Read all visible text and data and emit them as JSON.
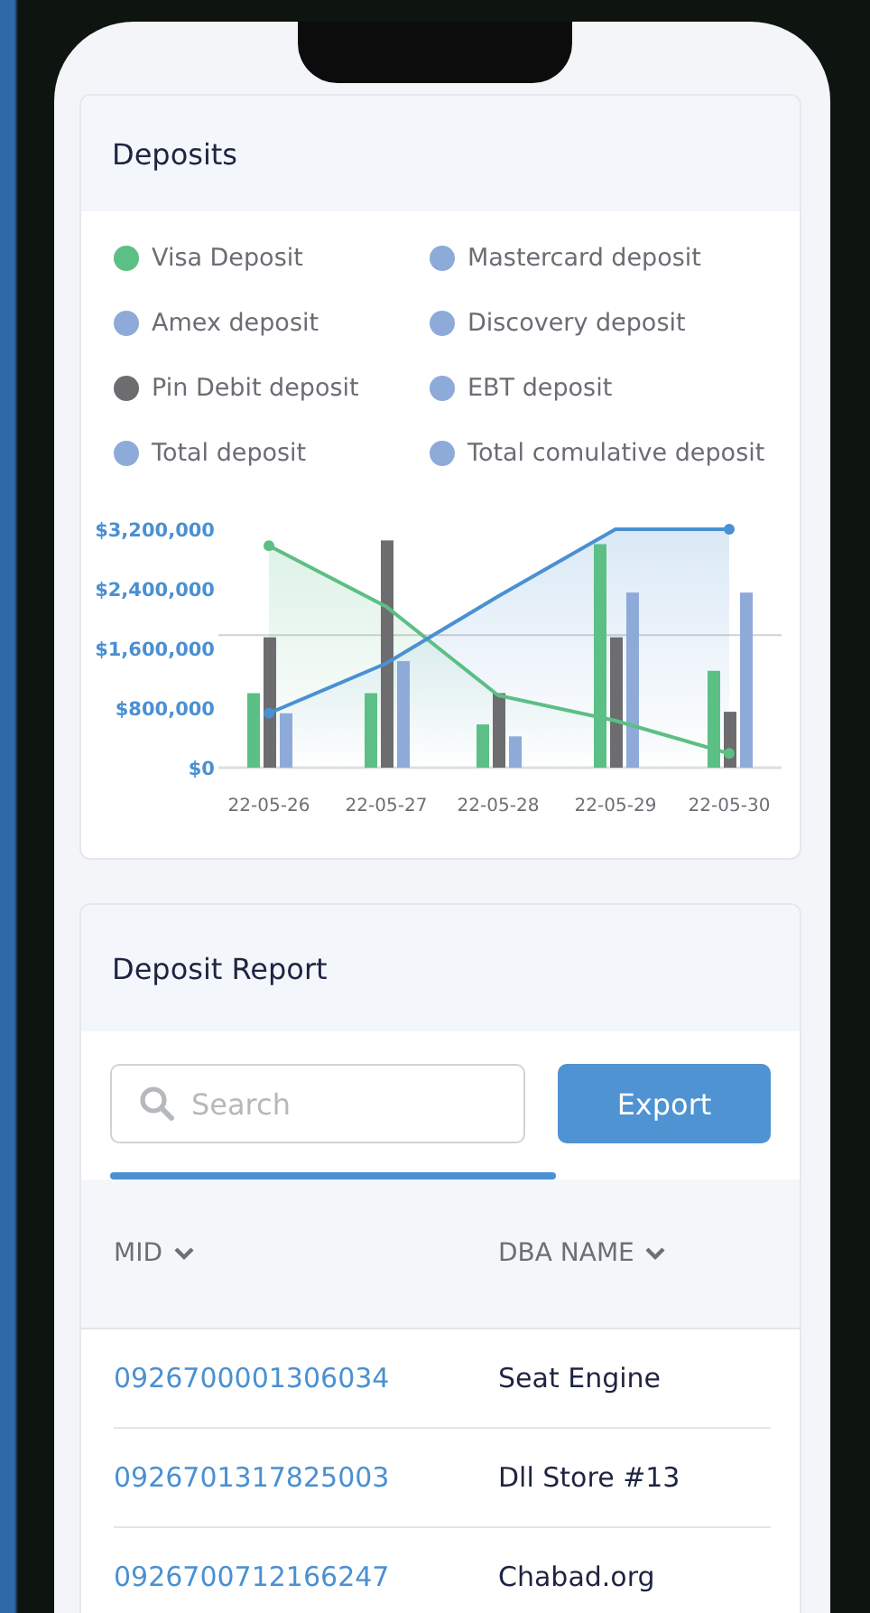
{
  "deposits": {
    "title": "Deposits",
    "legend": [
      {
        "label": "Visa Deposit",
        "color": "#5cbf85"
      },
      {
        "label": "Mastercard deposit",
        "color": "#8eaad9"
      },
      {
        "label": "Amex deposit",
        "color": "#8eaad9"
      },
      {
        "label": "Discovery deposit",
        "color": "#8eaad9"
      },
      {
        "label": "Pin Debit deposit",
        "color": "#6d6d6f"
      },
      {
        "label": "EBT deposit",
        "color": "#8eaad9"
      },
      {
        "label": "Total deposit",
        "color": "#8eaad9"
      },
      {
        "label": "Total comulative deposit",
        "color": "#8eaad9"
      }
    ],
    "chart_data": {
      "type": "bar",
      "categories": [
        "22-05-26",
        "22-05-27",
        "22-05-28",
        "22-05-29",
        "22-05-30"
      ],
      "ylim": [
        0,
        3200000
      ],
      "stacked": false,
      "ref_lines": [
        {
          "axis": "y",
          "value": 1780000
        }
      ],
      "yticks": [
        {
          "value": 0,
          "label": "$0"
        },
        {
          "value": 800000,
          "label": "$800,000"
        },
        {
          "value": 1600000,
          "label": "$1,600,000"
        },
        {
          "value": 2400000,
          "label": "$2,400,000"
        },
        {
          "value": 3200000,
          "label": "$3,200,000"
        }
      ],
      "series": [
        {
          "type": "bar",
          "color": "#5cbf85",
          "values": [
            1000000,
            1000000,
            580000,
            3000000,
            1300000
          ]
        },
        {
          "type": "bar",
          "color": "#6d6d6f",
          "values": [
            1750000,
            3050000,
            1000000,
            1750000,
            750000
          ]
        },
        {
          "type": "bar",
          "color": "#8eaad9",
          "values": [
            730000,
            1430000,
            420000,
            2350000,
            2350000
          ]
        },
        {
          "type": "area",
          "color": "#5cbf85",
          "values": [
            2980000,
            2160000,
            970000,
            630000,
            190000
          ]
        },
        {
          "type": "area",
          "color": "#4a90d2",
          "values": [
            730000,
            1400000,
            2300000,
            3200000,
            3200000
          ]
        }
      ]
    }
  },
  "report": {
    "title": "Deposit Report",
    "search": {
      "placeholder": "Search"
    },
    "export_button": "Export",
    "columns": [
      {
        "label": "MID"
      },
      {
        "label": "DBA NAME"
      }
    ],
    "rows": [
      [
        "0926700001306034",
        "Seat Engine"
      ],
      [
        "0926701317825003",
        "Dll Store #13"
      ],
      [
        "0926700712166247",
        "Chabad.org"
      ]
    ]
  }
}
